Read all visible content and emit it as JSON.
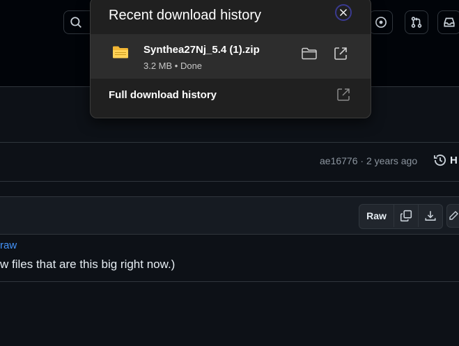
{
  "popup": {
    "title": "Recent download history",
    "item": {
      "filename": "Synthea27Nj_5.4 (1).zip",
      "meta": "3.2 MB • Done"
    },
    "full_history_label": "Full download history"
  },
  "commit": {
    "meta": "ae16776 · 2 years ago",
    "history_label": "H"
  },
  "file_actions": {
    "raw_label": "Raw"
  },
  "content": {
    "link_text": "raw",
    "body_text": "w files that are this big right now.)"
  },
  "colors": {
    "page_bg": "#0d1117",
    "header_bg": "#010409",
    "popup_bg": "#202020",
    "popup_item_bg": "#2d2d2d",
    "link": "#4493f8",
    "muted": "#8b949e",
    "zip_icon": "#f2b634"
  },
  "icons": [
    "search-icon",
    "issue-icon",
    "pull-request-icon",
    "inbox-icon",
    "close-icon",
    "zip-folder-icon",
    "folder-icon",
    "open-external-icon",
    "history-icon",
    "copy-icon",
    "download-icon",
    "pencil-icon"
  ]
}
